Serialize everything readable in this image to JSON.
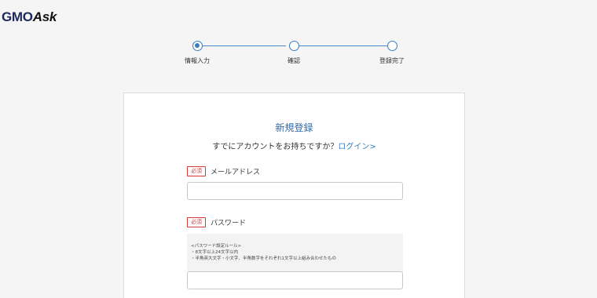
{
  "logo": {
    "part1": "GMO",
    "part2": "Ask"
  },
  "stepper": {
    "steps": [
      {
        "label": "情報入力",
        "active": true
      },
      {
        "label": "確認",
        "active": false
      },
      {
        "label": "登録完了",
        "active": false
      }
    ],
    "color": "#3a7dbf"
  },
  "form": {
    "title": "新規登録",
    "subtitle": "すでにアカウントをお持ちですか？",
    "login_link": "ログイン>",
    "required_badge": "必須",
    "email": {
      "label": "メールアドレス",
      "value": "",
      "placeholder": ""
    },
    "password": {
      "label": "パスワード",
      "value": "",
      "placeholder": "",
      "rules_title": "<パスワード設定ルール>",
      "rules": [
        "・8文字以上24文字以内",
        "・半角英大文字・小文字、半角数字をそれぞれ1文字以上組み合わせたもの"
      ]
    }
  },
  "colors": {
    "accent": "#3a7dbf",
    "required": "#d63b3b",
    "background": "#f5f5f5"
  }
}
